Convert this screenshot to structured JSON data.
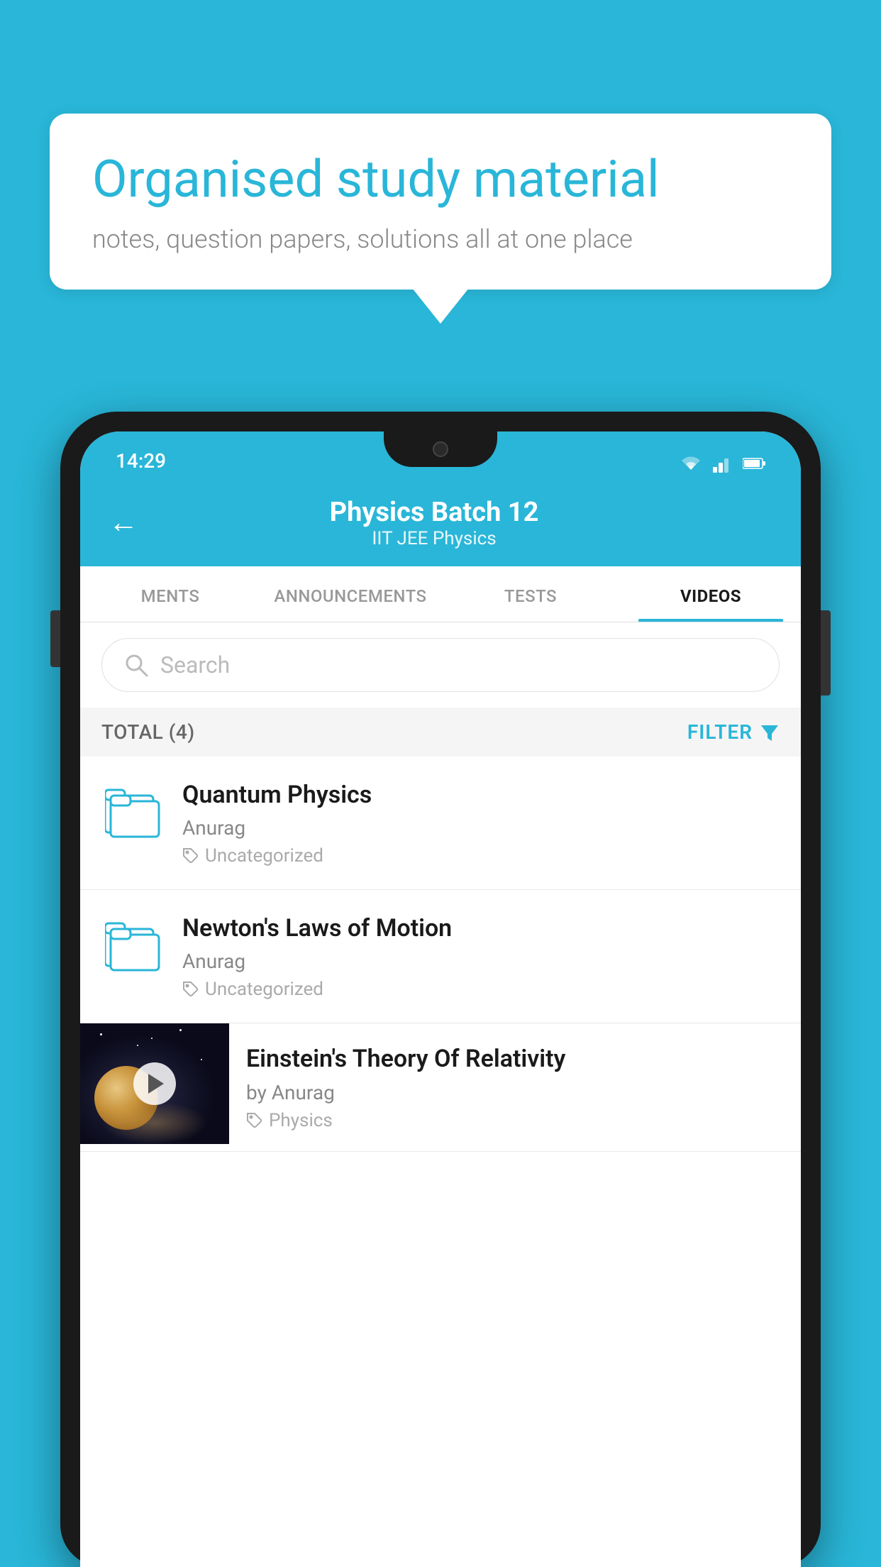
{
  "background_color": "#29b6d8",
  "speech_bubble": {
    "title": "Organised study material",
    "subtitle": "notes, question papers, solutions all at one place"
  },
  "status_bar": {
    "time": "14:29",
    "icons": [
      "wifi",
      "signal",
      "battery"
    ]
  },
  "app_header": {
    "title": "Physics Batch 12",
    "subtitle": "IIT JEE    Physics",
    "back_label": "←"
  },
  "tabs": [
    {
      "label": "MENTS",
      "active": false
    },
    {
      "label": "ANNOUNCEMENTS",
      "active": false
    },
    {
      "label": "TESTS",
      "active": false
    },
    {
      "label": "VIDEOS",
      "active": true
    }
  ],
  "search": {
    "placeholder": "Search"
  },
  "filter_bar": {
    "total_label": "TOTAL (4)",
    "filter_label": "FILTER"
  },
  "videos": [
    {
      "title": "Quantum Physics",
      "author": "Anurag",
      "tag": "Uncategorized",
      "has_thumb": false
    },
    {
      "title": "Newton's Laws of Motion",
      "author": "Anurag",
      "tag": "Uncategorized",
      "has_thumb": false
    },
    {
      "title": "Einstein's Theory Of Relativity",
      "author": "by Anurag",
      "tag": "Physics",
      "has_thumb": true
    }
  ]
}
